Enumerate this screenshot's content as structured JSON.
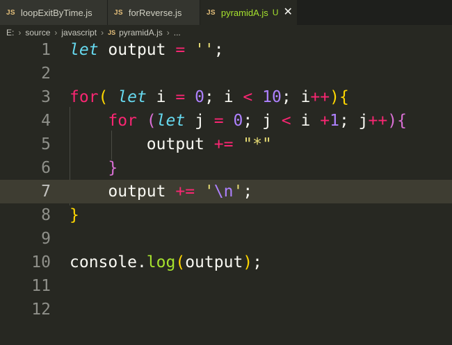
{
  "tabs": [
    {
      "icon": "JS",
      "label": "loopExitByTime.js"
    },
    {
      "icon": "JS",
      "label": "forReverse.js"
    },
    {
      "icon": "JS",
      "label": "pyramidA.js",
      "status": "U",
      "close": "✕"
    }
  ],
  "breadcrumb": {
    "drive": "E:",
    "folder1": "source",
    "folder2": "javascript",
    "file_icon": "JS",
    "file": "pyramidA.js",
    "more": "...",
    "separator": "›"
  },
  "line_numbers": [
    "1",
    "2",
    "3",
    "4",
    "5",
    "6",
    "7",
    "8",
    "9",
    "10",
    "11",
    "12"
  ],
  "code": {
    "l1": {
      "kw": "let",
      "id": "output",
      "op": "=",
      "str": "''",
      "semi": ";"
    },
    "l3": {
      "kw": "for",
      "p": "(",
      "kw2": "let",
      "id": "i",
      "op": "=",
      "n0": "0",
      "semi1": ";",
      "id2": "i",
      "lt": "<",
      "n10": "10",
      "semi2": ";",
      "id3": "i",
      "inc": "++",
      "pc": ")",
      "brace": "{"
    },
    "l4": {
      "kw": "for",
      "p": "(",
      "kw2": "let",
      "id": "j",
      "op": "=",
      "n0": "0",
      "semi1": ";",
      "id2": "j",
      "lt": "<",
      "id3": "i",
      "plus": "+",
      "n1": "1",
      "semi2": ";",
      "id4": "j",
      "inc": "++",
      "pc": ")",
      "brace": "{"
    },
    "l5": {
      "id": "output",
      "op": "+=",
      "str": "\"*\""
    },
    "l6": {
      "brace": "}"
    },
    "l7": {
      "id": "output",
      "op": "+=",
      "q1": "'",
      "esc": "\\n",
      "q2": "'",
      "semi": ";"
    },
    "l8": {
      "brace": "}"
    },
    "l10": {
      "obj": "console",
      "dot": ".",
      "fn": "log",
      "p": "(",
      "arg": "output",
      "pc": ")",
      "semi": ";"
    }
  }
}
